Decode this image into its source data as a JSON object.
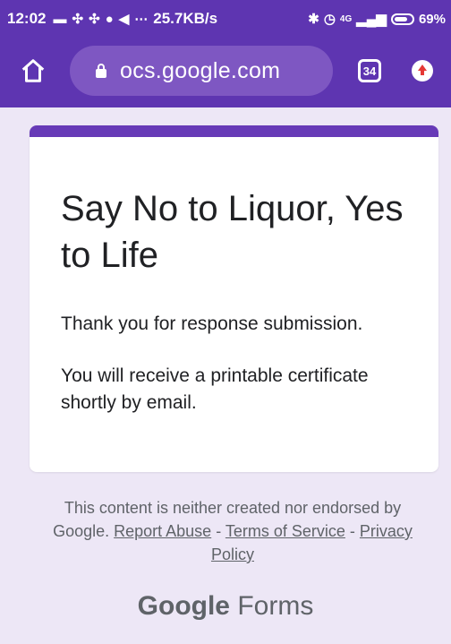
{
  "status_bar": {
    "time": "12:02",
    "network_speed": "25.7KB/s",
    "signal": "4G",
    "battery": "69%"
  },
  "browser": {
    "url": "ocs.google.com",
    "tab_count": "34"
  },
  "form": {
    "accent_color": "#673ab7",
    "title": "Say No to Liquor, Yes to Life",
    "message_1": "Thank you for response submission.",
    "message_2": "You will receive a printable certificate shortly by email."
  },
  "footer": {
    "disclaimer": "This content is neither created nor endorsed by Google.",
    "report_abuse": "Report Abuse",
    "sep1": " - ",
    "terms": "Terms of Service",
    "sep2": " - ",
    "privacy": "Privacy Policy"
  },
  "brand": {
    "google": "Google",
    "forms": "Forms"
  }
}
